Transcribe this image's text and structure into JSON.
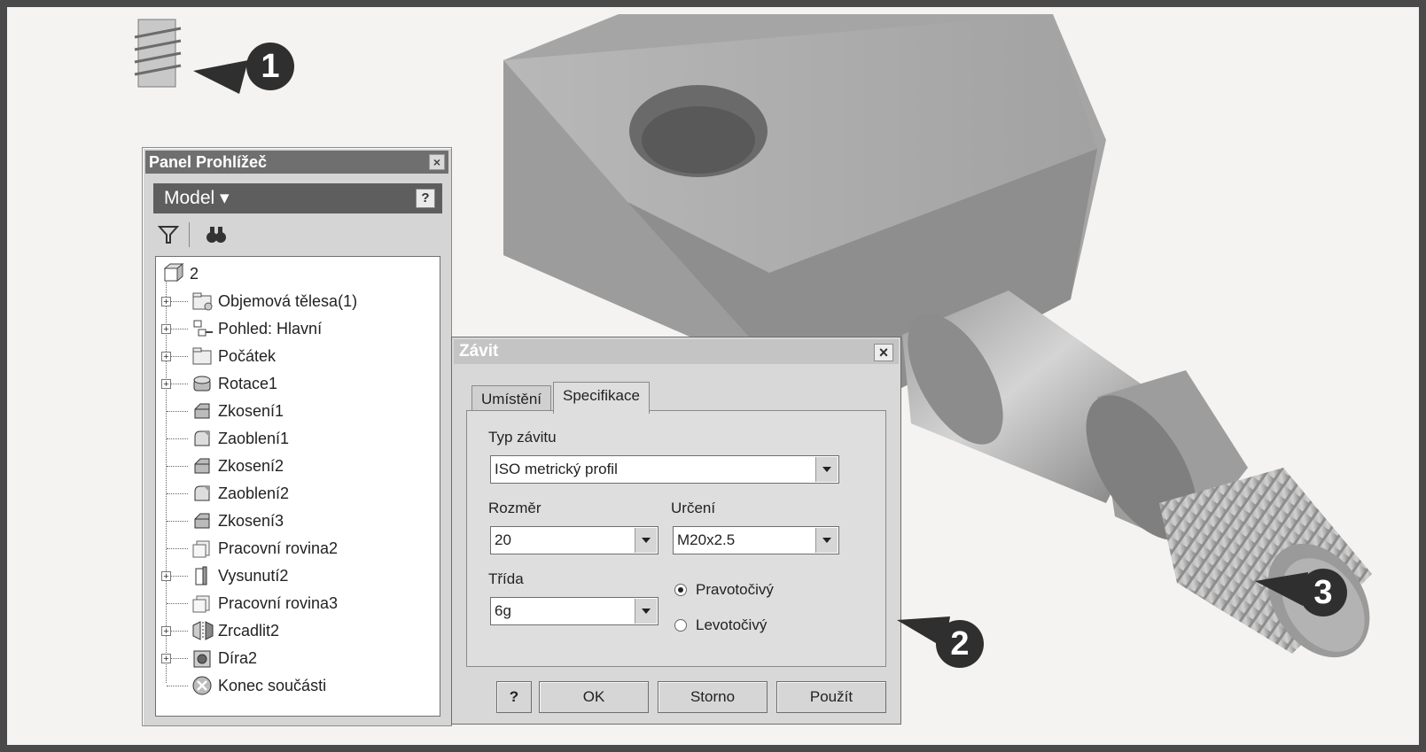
{
  "callouts": [
    "1",
    "2",
    "3"
  ],
  "thread_tool_icon": "thread-tool-icon",
  "browser": {
    "title": "Panel Prohlížeč",
    "close_glyph": "×",
    "model_label": "Model ▾",
    "help_glyph": "?",
    "toolbar_icons": [
      "filter-icon",
      "find-icon"
    ],
    "tree": [
      {
        "label": "2",
        "icon": "part-icon",
        "expander": ""
      },
      {
        "label": "Objemová tělesa(1)",
        "icon": "solid-bodies-folder-icon",
        "expander": "+"
      },
      {
        "label": "Pohled: Hlavní",
        "icon": "view-rep-icon",
        "expander": "+"
      },
      {
        "label": "Počátek",
        "icon": "origin-folder-icon",
        "expander": "+"
      },
      {
        "label": "Rotace1",
        "icon": "revolve-icon",
        "expander": "+"
      },
      {
        "label": "Zkosení1",
        "icon": "chamfer-icon",
        "expander": ""
      },
      {
        "label": "Zaoblení1",
        "icon": "fillet-icon",
        "expander": ""
      },
      {
        "label": "Zkosení2",
        "icon": "chamfer-icon",
        "expander": ""
      },
      {
        "label": "Zaoblení2",
        "icon": "fillet-icon",
        "expander": ""
      },
      {
        "label": "Zkosení3",
        "icon": "chamfer-icon",
        "expander": ""
      },
      {
        "label": "Pracovní rovina2",
        "icon": "work-plane-icon",
        "expander": ""
      },
      {
        "label": "Vysunutí2",
        "icon": "extrude-icon",
        "expander": "+"
      },
      {
        "label": "Pracovní rovina3",
        "icon": "work-plane-icon",
        "expander": ""
      },
      {
        "label": "Zrcadlit2",
        "icon": "mirror-icon",
        "expander": "+"
      },
      {
        "label": "Díra2",
        "icon": "hole-icon",
        "expander": "+"
      },
      {
        "label": "Konec součásti",
        "icon": "end-of-part-icon",
        "expander": ""
      }
    ]
  },
  "dialog": {
    "title": "Závit",
    "close_glyph": "×",
    "tabs": [
      "Umístění",
      "Specifikace"
    ],
    "active_tab": "Specifikace",
    "thread_type_label": "Typ závitu",
    "thread_type_value": "ISO metrický profil",
    "size_label": "Rozměr",
    "size_value": "20",
    "designation_label": "Určení",
    "designation_value": "M20x2.5",
    "class_label": "Třída",
    "class_value": "6g",
    "direction_options": [
      {
        "label": "Pravotočivý",
        "checked": true
      },
      {
        "label": "Levotočivý",
        "checked": false
      }
    ],
    "help_glyph": "?",
    "ok_label": "OK",
    "cancel_label": "Storno",
    "apply_label": "Použít"
  }
}
